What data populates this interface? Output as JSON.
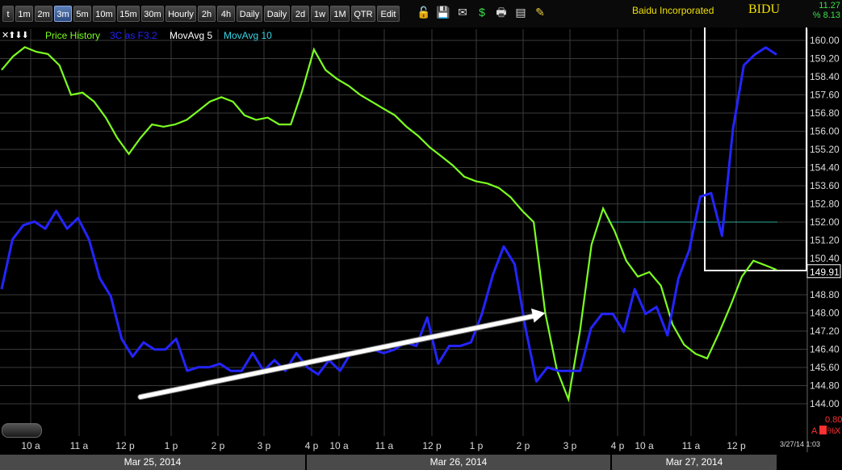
{
  "toolbar": {
    "timeframes": [
      "t",
      "1m",
      "2m",
      "3m",
      "5m",
      "10m",
      "15m",
      "30m",
      "Hourly",
      "2h",
      "4h",
      "Daily",
      "Daily",
      "2d",
      "1w",
      "1M",
      "QTR",
      "Edit"
    ],
    "active": "3m",
    "icons": [
      "lock-icon",
      "save-icon",
      "email-icon",
      "dollar-icon",
      "print-icon",
      "keyboard-icon",
      "pencil-icon"
    ]
  },
  "header": {
    "company": "Baidu Incorporated",
    "symbol": "BIDU",
    "change": "11.27",
    "change_pct": "% 8.13"
  },
  "legend": {
    "controls": "✕⬆⬇⬇",
    "price": "Price History",
    "indicator": "3C as F3.2",
    "ma5": "MovAvg 5",
    "ma10": "MovAvg 10"
  },
  "colors": {
    "price": "#7cff21",
    "indicator": "#2424ff",
    "ma10": "#38d6e6",
    "grid": "#3a3a3a",
    "arrow": "#ffffff",
    "box": "#ffffff",
    "hline": "#2fa89a"
  },
  "chart_data": {
    "type": "line",
    "title": "Baidu Incorporated BIDU",
    "y_ticks": [
      "160.00",
      "159.20",
      "158.40",
      "157.60",
      "156.80",
      "156.00",
      "155.20",
      "154.40",
      "153.60",
      "152.80",
      "152.00",
      "151.20",
      "150.40",
      "149.91",
      "148.80",
      "148.00",
      "147.20",
      "146.40",
      "145.60",
      "144.80",
      "144.00"
    ],
    "last_price": "149.91",
    "x_ticks": [
      "10 a",
      "11 a",
      "12 p",
      "1 p",
      "2 p",
      "3 p",
      "4 p",
      "10 a",
      "11 a",
      "12 p",
      "1 p",
      "2 p",
      "3 p",
      "4 p",
      "10 a",
      "11 a",
      "12 p"
    ],
    "dates": [
      "Mar 25, 2014",
      "Mar 26, 2014",
      "Mar 27, 2014"
    ],
    "timestamp": "3/27/14 1:03",
    "indicator_side": [
      "0.80",
      "A",
      "%",
      "X"
    ],
    "series": [
      {
        "name": "Price History",
        "values": [
          158.7,
          159.3,
          159.7,
          159.5,
          159.4,
          158.9,
          157.6,
          157.7,
          157.3,
          156.6,
          155.7,
          155.0,
          155.7,
          156.3,
          156.2,
          156.3,
          156.5,
          156.9,
          157.3,
          157.5,
          157.3,
          156.7,
          156.5,
          156.6,
          156.3,
          156.3,
          157.8,
          159.6,
          158.7,
          158.3,
          158.0,
          157.6,
          157.3,
          157.0,
          156.7,
          156.2,
          155.8,
          155.3,
          154.9,
          154.5,
          154.0,
          153.8,
          153.7,
          153.5,
          153.1,
          152.5,
          152.0,
          148.0,
          145.5,
          144.2,
          147.2,
          151.0,
          152.6,
          151.6,
          150.3,
          149.6,
          149.8,
          149.2,
          147.5,
          146.6,
          146.2,
          146.0,
          147.1,
          148.3,
          149.6,
          150.3,
          150.1,
          149.9
        ]
      },
      {
        "name": "3C as F3.2",
        "values": [
          30,
          44,
          48,
          49,
          47,
          52,
          47,
          50,
          44,
          33,
          28,
          16,
          11,
          15,
          13,
          13,
          16,
          7,
          8,
          8,
          9,
          7,
          7,
          12,
          7,
          10,
          7,
          12,
          8,
          6,
          10,
          7,
          12,
          12,
          13,
          12,
          13,
          15,
          14,
          22,
          9,
          14,
          14,
          15,
          23,
          34,
          42,
          37,
          19,
          4,
          8,
          7,
          7,
          7,
          19,
          23,
          23,
          18,
          30,
          23,
          25,
          17,
          33,
          41,
          56,
          57,
          45,
          75,
          93,
          96,
          98,
          96
        ]
      }
    ],
    "hline": 152.0,
    "arrow": {
      "from_x": 12,
      "from_y": 144.3,
      "to_x": 47,
      "to_y": 148.0
    }
  }
}
